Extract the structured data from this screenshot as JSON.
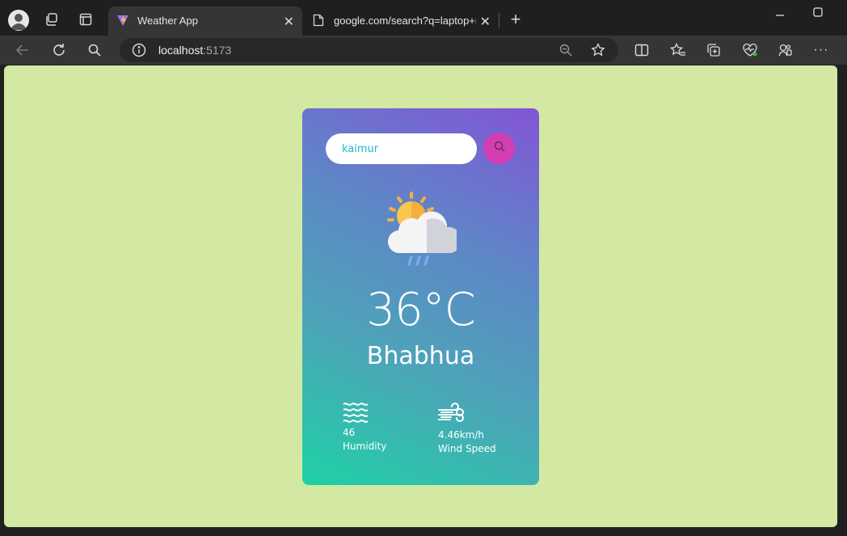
{
  "browser": {
    "tabs": [
      {
        "title": "Weather App",
        "active": true
      },
      {
        "title": "google.com/search?q=laptop+n",
        "active": false
      }
    ],
    "address": {
      "host": "localhost",
      "port": ":5173"
    }
  },
  "weather": {
    "search": {
      "value": "kaimur"
    },
    "condition_icon": "sun-cloud-rain-icon",
    "temperature": "36°C",
    "city": "Bhabhua",
    "humidity": {
      "value": "46",
      "label": "Humidity",
      "icon": "humidity-waves-icon"
    },
    "wind": {
      "value": "4.46km/h",
      "label": "Wind Speed",
      "icon": "wind-icon"
    }
  },
  "colors": {
    "page_background": "#d3e8a2",
    "card_gradient_start": "#1fd1a6",
    "card_gradient_end": "#8255d6",
    "search_button": "#d13fb3"
  }
}
